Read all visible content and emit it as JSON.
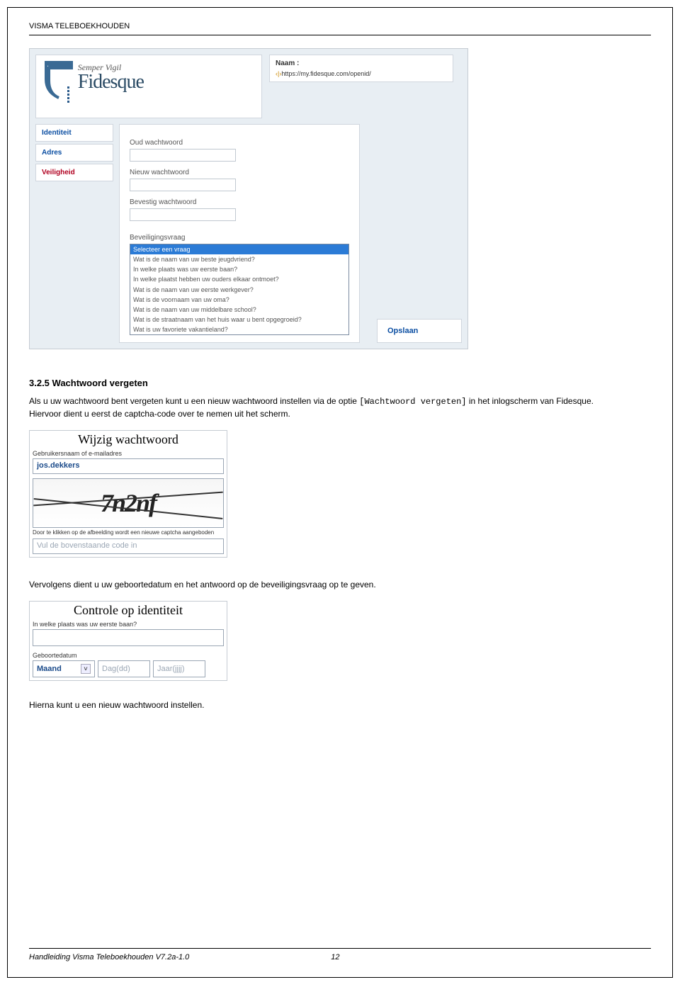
{
  "header": {
    "title": "VISMA TELEBOEKHOUDEN"
  },
  "fidesque_panel": {
    "motto": "Semper Vigil",
    "brand": "Fidesque",
    "naam_label": "Naam :",
    "naam_url": "https://my.fidesque.com/openid/",
    "nav": {
      "identiteit": "Identiteit",
      "adres": "Adres",
      "veiligheid": "Veiligheid"
    },
    "form": {
      "oud": "Oud wachtwoord",
      "nieuw": "Nieuw wachtwoord",
      "bevestig": "Bevestig wachtwoord",
      "vraag_label": "Beveiligingsvraag",
      "questions": [
        "Selecteer een vraag",
        "Wat is de naam van uw beste jeugdvriend?",
        "In welke plaats was uw eerste baan?",
        "In welke plaatst hebben uw ouders elkaar ontmoet?",
        "Wat is de naam van uw eerste werkgever?",
        "Wat is de voornaam van uw oma?",
        "Wat is de naam van uw middelbare school?",
        "Wat is de straatnaam van het huis waar u bent opgegroeid?",
        "Wat is uw favoriete vakantieland?"
      ]
    },
    "save": "Opslaan"
  },
  "section": {
    "number_title": "3.2.5 Wachtwoord vergeten",
    "p1_a": "Als u uw wachtwoord bent vergeten kunt u een nieuw wachtwoord instellen via de optie ",
    "p1_link": "[Wachtwoord vergeten]",
    "p1_b": " in het inlogscherm van Fidesque.",
    "p1_c": "Hiervoor dient u eerst de captcha-code over te nemen uit het scherm."
  },
  "wijzig": {
    "title": "Wijzig wachtwoord",
    "sub": "Gebruikersnaam of e-mailadres",
    "value": "jos.dekkers",
    "captcha_text": "7n2nf",
    "hint": "Door te klikken op de afbeelding wordt een nieuwe captcha aangeboden",
    "placeholder": "Vul de bovenstaande code in"
  },
  "vervolgens": "Vervolgens dient u uw geboortedatum en het antwoord op de beveiligingsvraag op te geven.",
  "identiteit": {
    "title": "Controle op identiteit",
    "question": "In welke plaats was uw eerste baan?",
    "gb_label": "Geboortedatum",
    "maand": "Maand",
    "dag": "Dag(dd)",
    "jaar": "Jaar(jjjj)"
  },
  "hierna": "Hierna kunt u een nieuw wachtwoord instellen.",
  "footer": {
    "left": "Handleiding Visma Teleboekhouden V7.2a-1.0",
    "page": "12"
  }
}
